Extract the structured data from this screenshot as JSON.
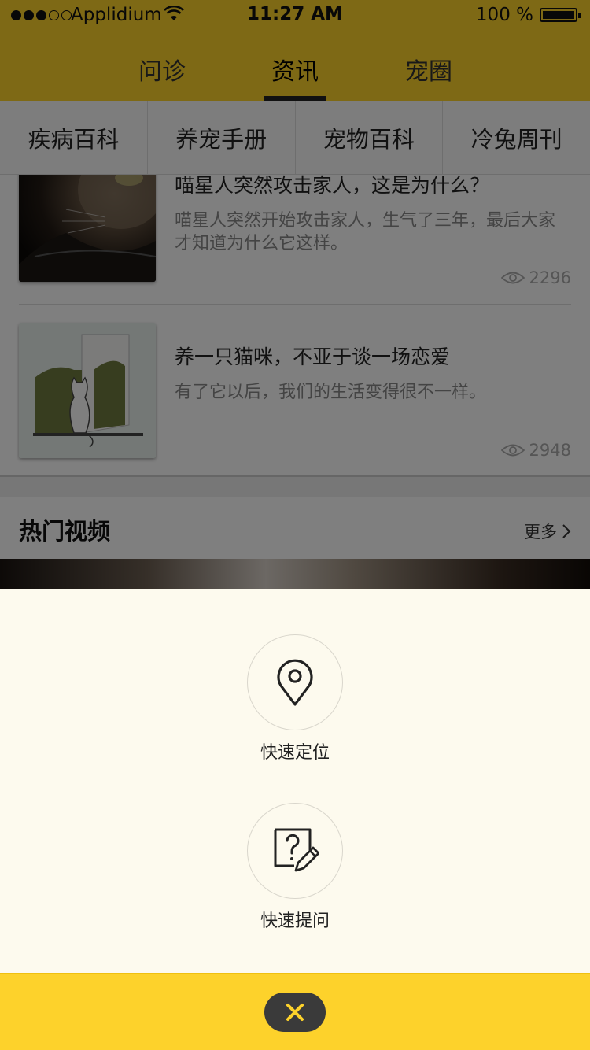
{
  "status_bar": {
    "carrier": "Applidium",
    "time": "11:27 AM",
    "battery": "100 %"
  },
  "top_tabs": [
    "问诊",
    "资讯",
    "宠圈"
  ],
  "active_tab": "资讯",
  "sub_tabs": [
    "疾病百科",
    "养宠手册",
    "宠物百科",
    "冷兔周刊"
  ],
  "articles": [
    {
      "title": "喵星人突然攻击家人，这是为什么？",
      "summary": "喵星人突然开始攻击家人，生气了三年，最后大家才知道为什么它这样。",
      "views": "2296"
    },
    {
      "title": "养一只猫咪，不亚于谈一场恋爱",
      "summary": "有了它以后，我们的生活变得很不一样。",
      "views": "2948"
    }
  ],
  "hot_videos": {
    "title": "热门视频",
    "more": "更多"
  },
  "actions": [
    {
      "label": "快速定位",
      "icon": "location-pin-icon"
    },
    {
      "label": "快速提问",
      "icon": "question-edit-icon"
    }
  ],
  "colors": {
    "accent_yellow": "#fdd22b",
    "sheet_background": "#fdfaee",
    "close_button": "#3a3a3a",
    "close_icon": "#fdd22b"
  }
}
